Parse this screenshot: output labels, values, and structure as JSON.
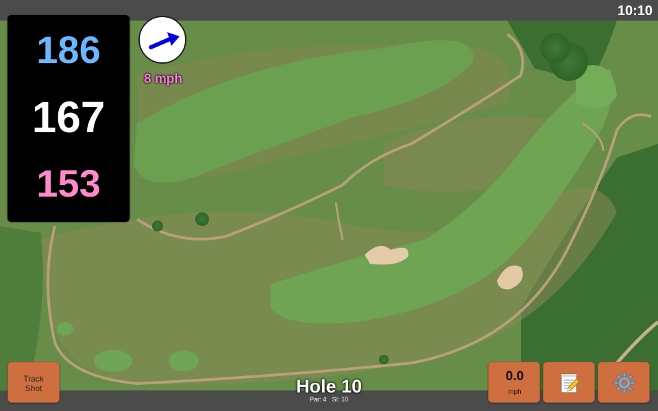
{
  "status_bar": {
    "time": "10:10"
  },
  "distances": {
    "back": "186",
    "middle": "167",
    "front": "153"
  },
  "wind": {
    "speed": "8 mph",
    "direction": "east-northeast"
  },
  "hole": {
    "title": "Hole 10",
    "par": "Par: 4",
    "stroke_index": "SI: 10"
  },
  "buttons": {
    "track_shot_line1": "Track",
    "track_shot_line2": "Shot",
    "speed_value": "0.0",
    "speed_unit": "mph",
    "scorecard_icon": "notepad-icon",
    "settings_icon": "gear-icon"
  },
  "colors": {
    "back_distance": "#6ab6ff",
    "middle_distance": "#ffffff",
    "front_distance": "#ff8acb",
    "wind_text": "#ff7ae0",
    "button_bg": "#cf6f3f",
    "wind_arrow": "#0000e0"
  }
}
